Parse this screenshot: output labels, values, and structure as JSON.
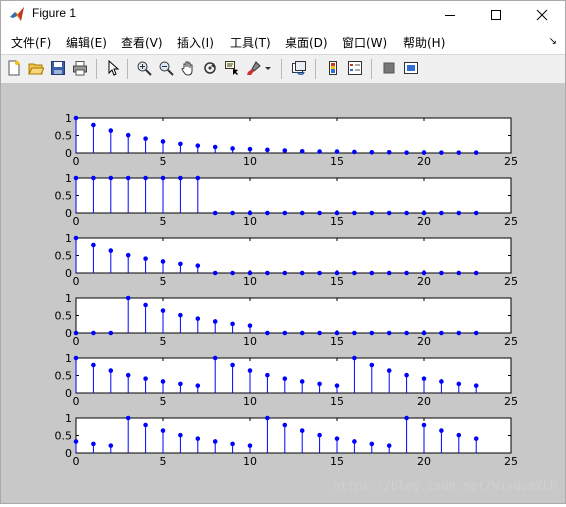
{
  "window": {
    "title": "Figure 1"
  },
  "menu": {
    "items": [
      "文件(F)",
      "编辑(E)",
      "查看(V)",
      "插入(I)",
      "工具(T)",
      "桌面(D)",
      "窗口(W)",
      "帮助(H)"
    ]
  },
  "toolbar": {
    "buttons": [
      "new-figure-icon",
      "open-file-icon",
      "save-icon",
      "print-icon",
      "edit-plot-arrow-icon",
      "zoom-in-icon",
      "zoom-out-icon",
      "pan-hand-icon",
      "rotate-3d-icon",
      "data-cursor-icon",
      "brush-icon",
      "link-plot-icon",
      "insert-colorbar-icon",
      "insert-legend-icon",
      "hide-plot-tools-icon",
      "show-plot-tools-icon"
    ]
  },
  "watermark": "https://blog.csdn.net/WisdomXLH",
  "colors": {
    "stem": "#0000ff",
    "figure_bg": "#c8c8c8",
    "axes_bg": "#ffffff"
  },
  "chart_data": [
    {
      "type": "stem",
      "x": [
        0,
        1,
        2,
        3,
        4,
        5,
        6,
        7,
        8,
        9,
        10,
        11,
        12,
        13,
        14,
        15,
        16,
        17,
        18,
        19,
        20,
        21,
        22,
        23
      ],
      "values": [
        1,
        0.8,
        0.64,
        0.51,
        0.41,
        0.33,
        0.26,
        0.21,
        0.17,
        0.13,
        0.11,
        0.09,
        0.07,
        0.05,
        0.04,
        0.04,
        0.03,
        0.02,
        0.02,
        0.01,
        0.01,
        0.01,
        0.01,
        0.01
      ],
      "xlim": [
        0,
        25
      ],
      "ylim": [
        0,
        1
      ],
      "xticks": [
        "0",
        "5",
        "10",
        "15",
        "20",
        "25"
      ],
      "yticks": [
        "0",
        "0.5",
        "1"
      ]
    },
    {
      "type": "stem",
      "x": [
        0,
        1,
        2,
        3,
        4,
        5,
        6,
        7,
        8,
        9,
        10,
        11,
        12,
        13,
        14,
        15,
        16,
        17,
        18,
        19,
        20,
        21,
        22,
        23
      ],
      "values": [
        1,
        1,
        1,
        1,
        1,
        1,
        1,
        1,
        0,
        0,
        0,
        0,
        0,
        0,
        0,
        0,
        0,
        0,
        0,
        0,
        0,
        0,
        0,
        0
      ],
      "xlim": [
        0,
        25
      ],
      "ylim": [
        0,
        1
      ],
      "xticks": [
        "0",
        "5",
        "10",
        "15",
        "20",
        "25"
      ],
      "yticks": [
        "0",
        "0.5",
        "1"
      ]
    },
    {
      "type": "stem",
      "x": [
        0,
        1,
        2,
        3,
        4,
        5,
        6,
        7,
        8,
        9,
        10,
        11,
        12,
        13,
        14,
        15,
        16,
        17,
        18,
        19,
        20,
        21,
        22,
        23
      ],
      "values": [
        1,
        0.8,
        0.64,
        0.51,
        0.41,
        0.33,
        0.26,
        0.21,
        0,
        0,
        0,
        0,
        0,
        0,
        0,
        0,
        0,
        0,
        0,
        0,
        0,
        0,
        0,
        0
      ],
      "xlim": [
        0,
        25
      ],
      "ylim": [
        0,
        1
      ],
      "xticks": [
        "0",
        "5",
        "10",
        "15",
        "20",
        "25"
      ],
      "yticks": [
        "0",
        "0.5",
        "1"
      ]
    },
    {
      "type": "stem",
      "x": [
        0,
        1,
        2,
        3,
        4,
        5,
        6,
        7,
        8,
        9,
        10,
        11,
        12,
        13,
        14,
        15,
        16,
        17,
        18,
        19,
        20,
        21,
        22,
        23
      ],
      "values": [
        0,
        0,
        0,
        1,
        0.8,
        0.64,
        0.51,
        0.41,
        0.33,
        0.26,
        0.21,
        0,
        0,
        0,
        0,
        0,
        0,
        0,
        0,
        0,
        0,
        0,
        0,
        0
      ],
      "xlim": [
        0,
        25
      ],
      "ylim": [
        0,
        1
      ],
      "xticks": [
        "0",
        "5",
        "10",
        "15",
        "20",
        "25"
      ],
      "yticks": [
        "0",
        "0.5",
        "1"
      ]
    },
    {
      "type": "stem",
      "x": [
        0,
        1,
        2,
        3,
        4,
        5,
        6,
        7,
        8,
        9,
        10,
        11,
        12,
        13,
        14,
        15,
        16,
        17,
        18,
        19,
        20,
        21,
        22,
        23
      ],
      "values": [
        1,
        0.8,
        0.64,
        0.51,
        0.41,
        0.33,
        0.26,
        0.21,
        1,
        0.8,
        0.64,
        0.51,
        0.41,
        0.33,
        0.26,
        0.21,
        1,
        0.8,
        0.64,
        0.51,
        0.41,
        0.33,
        0.26,
        0.21
      ],
      "xlim": [
        0,
        25
      ],
      "ylim": [
        0,
        1
      ],
      "xticks": [
        "0",
        "5",
        "10",
        "15",
        "20",
        "25"
      ],
      "yticks": [
        "0",
        "0.5",
        "1"
      ]
    },
    {
      "type": "stem",
      "x": [
        0,
        1,
        2,
        3,
        4,
        5,
        6,
        7,
        8,
        9,
        10,
        11,
        12,
        13,
        14,
        15,
        16,
        17,
        18,
        19,
        20,
        21,
        22,
        23
      ],
      "values": [
        0.33,
        0.26,
        0.21,
        1,
        0.8,
        0.64,
        0.51,
        0.41,
        0.33,
        0.26,
        0.21,
        1,
        0.8,
        0.64,
        0.51,
        0.41,
        0.33,
        0.26,
        0.21,
        1,
        0.8,
        0.64,
        0.51,
        0.41
      ],
      "xlim": [
        0,
        25
      ],
      "ylim": [
        0,
        1
      ],
      "xticks": [
        "0",
        "5",
        "10",
        "15",
        "20",
        "25"
      ],
      "yticks": [
        "0",
        "0.5",
        "1"
      ]
    }
  ]
}
